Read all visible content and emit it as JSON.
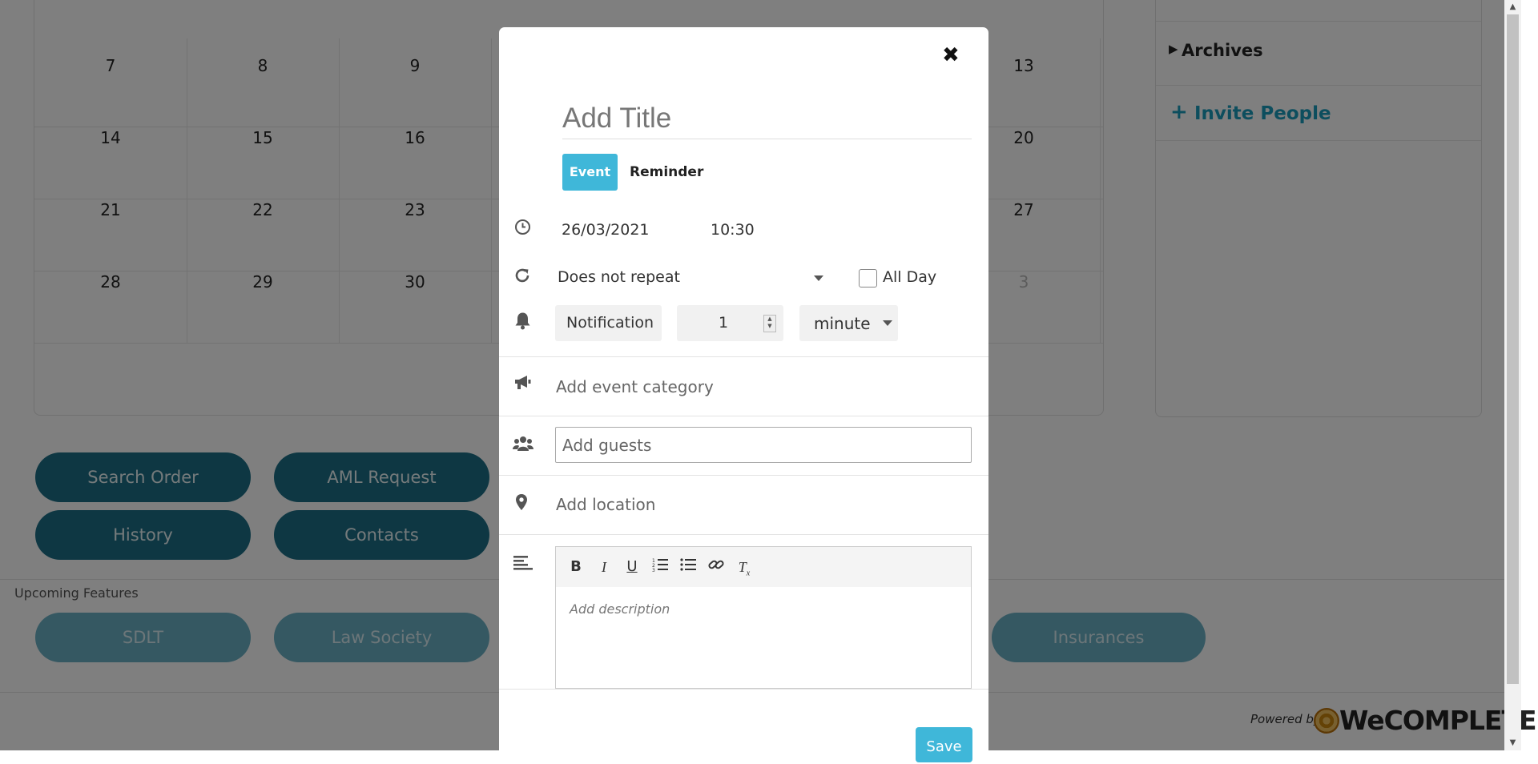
{
  "calendar": {
    "rows": [
      [
        "7",
        "8",
        "9",
        "",
        "",
        "",
        "13"
      ],
      [
        "14",
        "15",
        "16",
        "",
        "",
        "",
        "20"
      ],
      [
        "21",
        "22",
        "23",
        "",
        "",
        "",
        "27"
      ],
      [
        "28",
        "29",
        "30",
        "",
        "",
        "",
        "3"
      ]
    ]
  },
  "sidebar": {
    "archives_label": "Archives",
    "invite_label": "Invite People"
  },
  "actions": {
    "search_order": "Search Order",
    "aml_request": "AML Request",
    "history": "History",
    "contacts": "Contacts"
  },
  "upcoming": {
    "label": "Upcoming Features",
    "sdlt": "SDLT",
    "law_society": "Law Society",
    "insurances": "Insurances"
  },
  "footer": {
    "powered_by": "Powered by",
    "brand": "WeCOMPLETE"
  },
  "modal": {
    "close_glyph": "✖",
    "title_placeholder": "Add Title",
    "event_tab": "Event",
    "reminder_tab": "Reminder",
    "date": "26/03/2021",
    "time": "10:30",
    "repeat": "Does not repeat",
    "all_day_label": "All Day",
    "notification_label": "Notification",
    "notification_value": "1",
    "notification_unit": "minute",
    "category_placeholder": "Add event category",
    "guests_placeholder": "Add guests",
    "location_placeholder": "Add location",
    "description_placeholder": "Add description",
    "save_label": "Save"
  },
  "icons": [
    "clock-icon",
    "repeat-icon",
    "bell-icon",
    "megaphone-icon",
    "users-icon",
    "map-pin-icon",
    "align-left-icon",
    "bold-icon",
    "italic-icon",
    "underline-icon",
    "ordered-list-icon",
    "bullet-list-icon",
    "link-icon",
    "clear-format-icon"
  ],
  "colors": {
    "accent": "#3fb7d9",
    "pill": "#1c6f86",
    "invite": "#1b9dbd"
  }
}
